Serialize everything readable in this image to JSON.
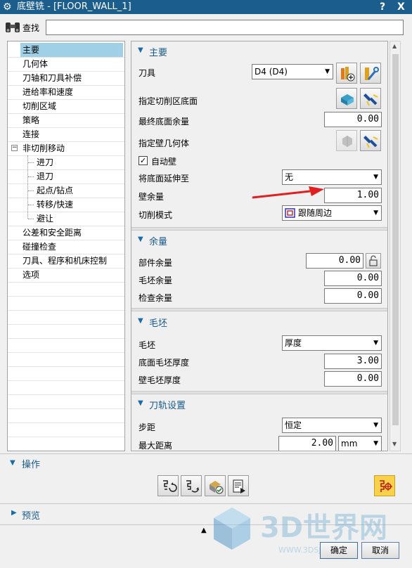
{
  "window": {
    "title": "底壁铣 - [FLOOR_WALL_1]",
    "help": "?",
    "close": "X"
  },
  "search": {
    "label": "查找",
    "value": ""
  },
  "tree": {
    "items": [
      "主要",
      "几何体",
      "刀轴和刀具补偿",
      "进给率和速度",
      "切削区域",
      "策略",
      "连接",
      "非切削移动",
      "进刀",
      "退刀",
      "起点/钻点",
      "转移/快速",
      "避让",
      "公差和安全距离",
      "碰撞检查",
      "刀具、程序和机床控制",
      "选项"
    ],
    "expander": "−"
  },
  "main_section": {
    "title": "主要",
    "tool_label": "刀具",
    "tool_value": "D4 (D4)",
    "cut_area_label": "指定切削区底面",
    "final_floor_label": "最终底面余量",
    "final_floor_value": "0.00",
    "wall_geom_label": "指定壁几何体",
    "auto_wall_label": "自动壁",
    "auto_wall_checked": true,
    "extend_label": "将底面延伸至",
    "extend_value": "无",
    "wall_stock_label": "壁余量",
    "wall_stock_value": "1.00",
    "cut_pattern_label": "切削模式",
    "cut_pattern_value": "跟随周边"
  },
  "stock_section": {
    "title": "余量",
    "part_label": "部件余量",
    "part_value": "0.00",
    "blank_label": "毛坯余量",
    "blank_value": "0.00",
    "check_label": "检查余量",
    "check_value": "0.00"
  },
  "blank_section": {
    "title": "毛坯",
    "blank_label": "毛坯",
    "blank_value": "厚度",
    "floor_label": "底面毛坯厚度",
    "floor_value": "3.00",
    "wall_label": "壁毛坯厚度",
    "wall_value": "0.00"
  },
  "path_section": {
    "title": "刀轨设置",
    "step_label": "步距",
    "step_value": "恒定",
    "maxdist_label": "最大距离",
    "maxdist_value": "2.00",
    "maxdist_unit": "mm"
  },
  "operation": {
    "title": "操作"
  },
  "preview": {
    "title": "预览"
  },
  "buttons": {
    "ok": "确定",
    "cancel": "取消"
  },
  "watermark": {
    "text": "3D世界网",
    "sub": "WWW.3DSJW.COM"
  },
  "colors": {
    "titlebar": "#1b5d8c",
    "selected": "#9fd0e8",
    "accent": "#1a6ca8",
    "arrow": "#e02020"
  }
}
